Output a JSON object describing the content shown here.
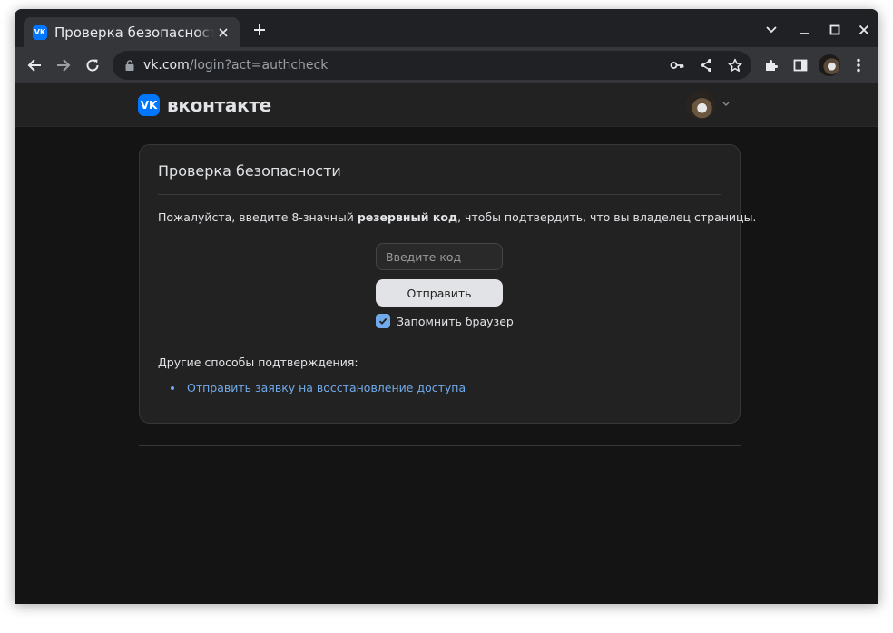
{
  "browser": {
    "tab": {
      "title": "Проверка безопасности | ВКонтакте",
      "favicon_text": "VK"
    },
    "url": {
      "host": "vk.com",
      "path": "/login?act=authcheck"
    }
  },
  "site": {
    "logo_text": "VK",
    "wordmark": "вконтакте"
  },
  "card": {
    "title": "Проверка безопасности",
    "desc_before": "Пожалуйста, введите 8-значный ",
    "desc_bold": "резервный код",
    "desc_after": ", чтобы подтвердить, что вы владелец страницы.",
    "code_placeholder": "Введите код",
    "code_value": "",
    "submit_label": "Отправить",
    "remember_label": "Запомнить браузер",
    "remember_checked": true,
    "other_title": "Другие способы подтверждения:",
    "other_links": [
      "Отправить заявку на восстановление доступа"
    ]
  },
  "colors": {
    "accent": "#0077ff",
    "link": "#71aaeb",
    "page_bg": "#141414",
    "card_bg": "#222222"
  }
}
